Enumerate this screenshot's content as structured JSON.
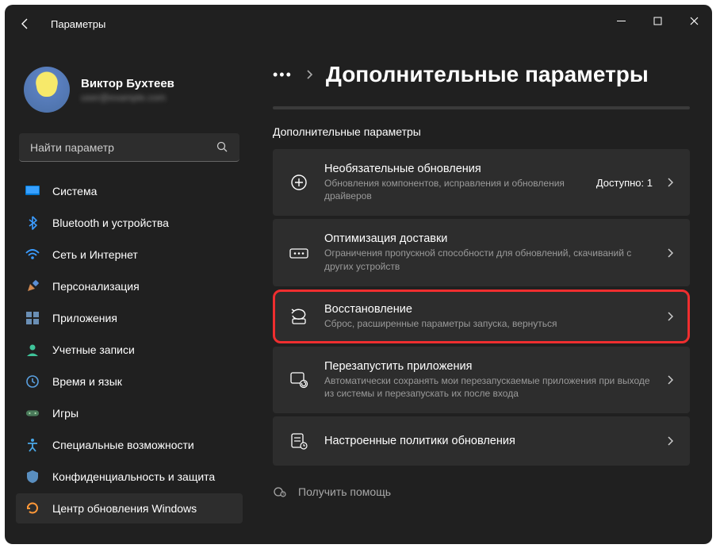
{
  "window": {
    "title": "Параметры"
  },
  "profile": {
    "name": "Виктор Бухтеев",
    "email": "user@example.com"
  },
  "search": {
    "placeholder": "Найти параметр"
  },
  "nav": [
    {
      "label": "Система",
      "icon": "system"
    },
    {
      "label": "Bluetooth и устройства",
      "icon": "bluetooth"
    },
    {
      "label": "Сеть и Интернет",
      "icon": "network"
    },
    {
      "label": "Персонализация",
      "icon": "personalization"
    },
    {
      "label": "Приложения",
      "icon": "apps"
    },
    {
      "label": "Учетные записи",
      "icon": "accounts"
    },
    {
      "label": "Время и язык",
      "icon": "time"
    },
    {
      "label": "Игры",
      "icon": "gaming"
    },
    {
      "label": "Специальные возможности",
      "icon": "accessibility"
    },
    {
      "label": "Конфиденциальность и защита",
      "icon": "privacy"
    },
    {
      "label": "Центр обновления Windows",
      "icon": "update"
    }
  ],
  "nav_active_index": 10,
  "breadcrumb": {
    "title": "Дополнительные параметры"
  },
  "section_label": "Дополнительные параметры",
  "cards": [
    {
      "title": "Необязательные обновления",
      "desc": "Обновления компонентов, исправления и обновления драйверов",
      "right": "Доступно: 1",
      "highlight": false,
      "icon": "plus"
    },
    {
      "title": "Оптимизация доставки",
      "desc": "Ограничения пропускной способности для обновлений, скачиваний с других устройств",
      "right": "",
      "highlight": false,
      "icon": "delivery"
    },
    {
      "title": "Восстановление",
      "desc": "Сброс, расширенные параметры запуска, вернуться",
      "right": "",
      "highlight": true,
      "icon": "recovery"
    },
    {
      "title": "Перезапустить приложения",
      "desc": "Автоматически сохранять мои перезапускаемые приложения при выходе из системы и перезапускать их после входа",
      "right": "",
      "highlight": false,
      "icon": "restart"
    },
    {
      "title": "Настроенные политики обновления",
      "desc": "",
      "right": "",
      "highlight": false,
      "icon": "policy"
    }
  ],
  "help": {
    "label": "Получить помощь"
  }
}
